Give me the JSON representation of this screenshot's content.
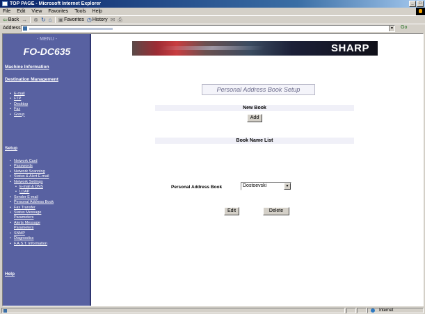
{
  "window": {
    "title": "TOP PAGE - Microsoft Internet Explorer",
    "min_glyph": "_",
    "max_glyph": "□",
    "close_glyph": "×"
  },
  "menubar": [
    "File",
    "Edit",
    "View",
    "Favorites",
    "Tools",
    "Help"
  ],
  "toolbar": {
    "back": "Back",
    "favorites": "Favorites",
    "history": "History"
  },
  "address": {
    "label": "Address",
    "go": "Go"
  },
  "sidebar": {
    "menu_title": "- MENU -",
    "model": "FO-DC635",
    "machine_information": "Machine Information",
    "destination_management": "Destination Management",
    "destination_items": [
      "E-mail",
      "FTP",
      "Desktop",
      "Fax",
      "Group"
    ],
    "setup": "Setup",
    "setup_items": [
      {
        "label": "Network Card",
        "level": 0
      },
      {
        "label": "Passwords",
        "level": 0
      },
      {
        "label": "Network Scanning",
        "level": 0
      },
      {
        "label": "Status & Alert E-mail",
        "level": 0
      },
      {
        "label": "Network Settings",
        "level": 0
      },
      {
        "label": "E-mail & DNS",
        "level": 1
      },
      {
        "label": "LDAP",
        "level": 1
      },
      {
        "label": "Sender E-mail",
        "level": 0
      },
      {
        "label": "Personal Address Book",
        "level": 0
      },
      {
        "label": "Fax Transfer",
        "level": 0
      },
      {
        "label": "Status Message",
        "level": 0
      },
      {
        "label": "Parameters",
        "level": 0,
        "continuation": true
      },
      {
        "label": "Alerts Message",
        "level": 0
      },
      {
        "label": "Parameters",
        "level": 0,
        "continuation": true
      },
      {
        "label": "SNMP",
        "level": 0
      },
      {
        "label": "Diagnostics",
        "level": 0
      },
      {
        "label": "F.A.S.T. Information",
        "level": 0
      }
    ],
    "help": "Help"
  },
  "main": {
    "brand": "SHARP",
    "page_title": "Personal Address Book Setup",
    "new_book_heading": "New Book",
    "add_button": "Add",
    "book_list_heading": "Book Name List",
    "book_label": "Personal Address Book",
    "book_selected": "Dostoevski",
    "edit_button": "Edit",
    "delete_button": "Delete"
  },
  "statusbar": {
    "zone": "Internet"
  }
}
